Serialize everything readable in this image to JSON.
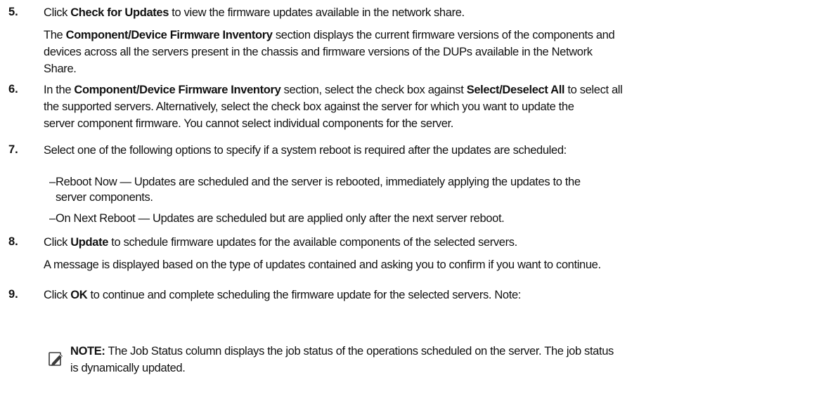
{
  "steps": {
    "s5": {
      "num": "5.",
      "l1": {
        "a": "Click ",
        "b": "Check for Updates",
        "c": " to view the firmware updates available in the network share."
      },
      "l2": {
        "a": "The ",
        "b": "Component/Device Firmware Inventory",
        "c": " section displays the current firmware versions of the components and"
      },
      "l3": "devices across all the servers present in the chassis and firmware versions of the DUPs available in the Network",
      "l4": "Share."
    },
    "s6": {
      "num": "6.",
      "l1": {
        "a": "In the ",
        "b": "Component/Device Firmware Inventory",
        "c": " section, select the check box against ",
        "d": "Select/Deselect All",
        "e": " to select all"
      },
      "l2": "the supported servers. Alternatively, select the check box against the server for which you want to update the",
      "l3": "server component firmware. You cannot select individual components for the server."
    },
    "s7": {
      "num": "7.",
      "l1": "Select one of the following options to specify if a system reboot is required after the updates are scheduled:",
      "opt1": {
        "dash": "–",
        "l1": "Reboot Now — Updates are scheduled and the server is rebooted, immediately applying the updates to the",
        "l2": "server components."
      },
      "opt2": {
        "dash": "–",
        "l1": "On Next Reboot — Updates are scheduled but are applied only after the next server reboot."
      }
    },
    "s8": {
      "num": "8.",
      "l1": {
        "a": "Click ",
        "b": "Update",
        "c": " to schedule firmware updates for the available components of the selected servers."
      },
      "l2": "A message is displayed based on the type of updates contained and asking you to confirm if you want to continue."
    },
    "s9": {
      "num": "9.",
      "l1": {
        "a": "Click ",
        "b": "OK",
        "c": " to continue and complete scheduling the firmware update for the selected servers. Note:"
      }
    }
  },
  "note": {
    "icon": "pencil-note-icon",
    "label": "NOTE:",
    "l1": " The Job Status column displays the job status of the operations scheduled on the server. The job status",
    "l2": "is dynamically updated."
  }
}
